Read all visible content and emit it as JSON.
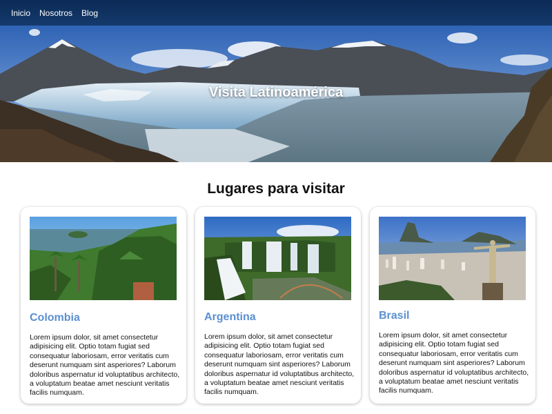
{
  "nav": {
    "items": [
      {
        "label": "Inicio"
      },
      {
        "label": "Nosotros"
      },
      {
        "label": "Blog"
      }
    ]
  },
  "hero": {
    "title": "Visita Latinoamérica"
  },
  "main": {
    "section_title": "Lugares para visitar",
    "cards": [
      {
        "title": "Colombia",
        "text": "Lorem ipsum dolor, sit amet consectetur adipisicing elit. Optio totam fugiat sed consequatur laboriosam, error veritatis cum deserunt numquam sint asperiores? Laborum doloribus aspernatur id voluptatibus architecto, a voluptatum beatae amet nesciunt veritatis facilis numquam."
      },
      {
        "title": "Argentina",
        "text": "Lorem ipsum dolor, sit amet consectetur adipisicing elit. Optio totam fugiat sed consequatur laboriosam, error veritatis cum deserunt numquam sint asperiores? Laborum doloribus aspernatur id voluptatibus architecto, a voluptatum beatae amet nesciunt veritatis facilis numquam."
      },
      {
        "title": "Brasil",
        "text": "Lorem ipsum dolor, sit amet consectetur adipisicing elit. Optio totam fugiat sed consequatur laboriosam, error veritatis cum deserunt numquam sint asperiores? Laborum doloribus aspernatur id voluptatibus architecto, a voluptatum beatae amet nesciunt veritatis facilis numquam."
      }
    ]
  },
  "colors": {
    "navbar": "#0b2a55",
    "card_title": "#5b8fd1",
    "text": "#111111"
  }
}
